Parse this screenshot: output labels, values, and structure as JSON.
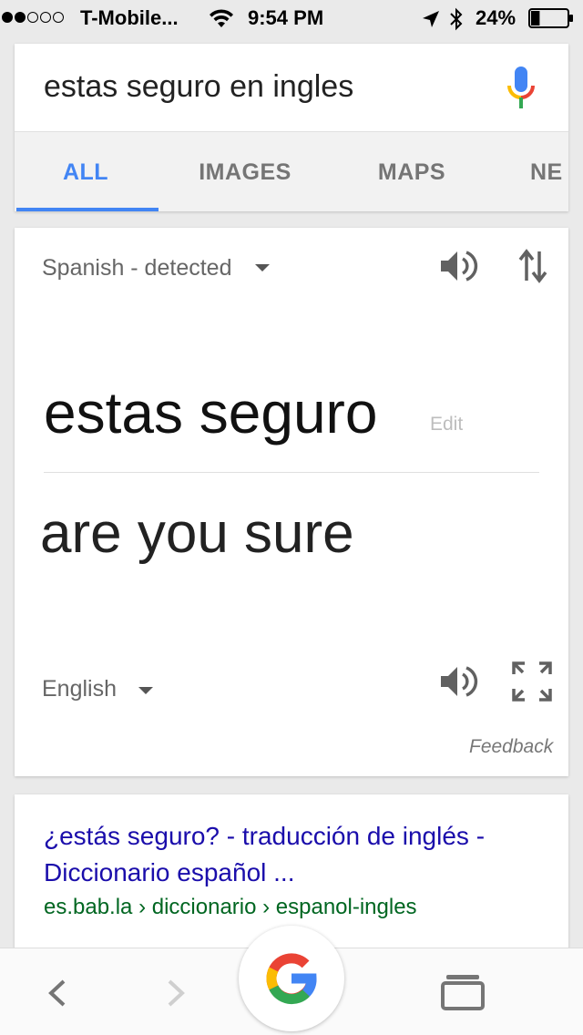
{
  "status_bar": {
    "carrier": "T-Mobile...",
    "time": "9:54 PM",
    "battery_percent": "24%",
    "battery_level": 0.24,
    "signal_bars_filled": 2,
    "signal_bars_total": 5
  },
  "search": {
    "query": "estas seguro en ingles",
    "tabs": [
      {
        "label": "ALL",
        "active": true
      },
      {
        "label": "IMAGES",
        "active": false
      },
      {
        "label": "MAPS",
        "active": false
      },
      {
        "label": "NE",
        "active": false
      }
    ]
  },
  "translate": {
    "source_language": "Spanish - detected",
    "source_text": "estas seguro",
    "edit_label": "Edit",
    "target_text": "are you sure",
    "target_language": "English",
    "feedback_label": "Feedback"
  },
  "result": {
    "title": "¿estás seguro? - traducción de inglés - Diccionario español ...",
    "url": "es.bab.la › diccionario › espanol-ingles"
  },
  "colors": {
    "accent_blue": "#4285f4",
    "link_blue": "#1a0dab",
    "url_green": "#006621"
  },
  "icons": {
    "mic": "microphone-icon",
    "speaker": "speaker-icon",
    "swap": "swap-languages-icon",
    "expand": "fullscreen-icon",
    "back": "chevron-left-icon",
    "forward": "chevron-right-icon",
    "google": "google-g-icon",
    "tabs": "tabs-switcher-icon"
  }
}
